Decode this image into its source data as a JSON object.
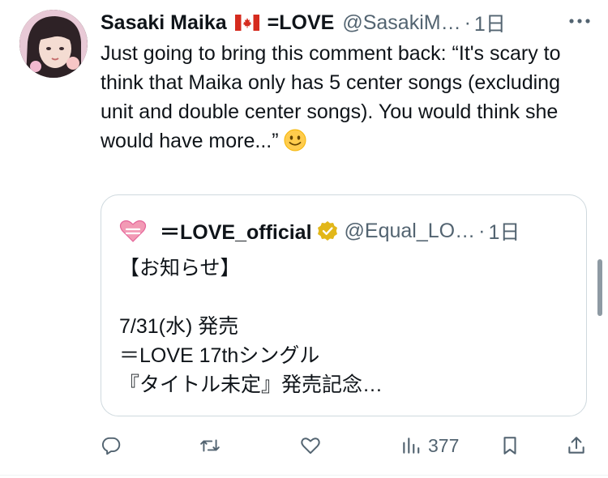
{
  "post": {
    "display_name": "Sasaki Maika",
    "display_name_suffix": "=LOVE",
    "handle": "@SasakiM…",
    "separator": "·",
    "time": "1日",
    "text": "Just going to bring this comment back: “It's scary to think that Maika only has 5 center songs (excluding unit and double center songs). You would think she would have more...”"
  },
  "quote": {
    "display_name": "＝LOVE_official",
    "handle": "@Equal_LO…",
    "separator": "·",
    "time": "1日",
    "text": "【お知らせ】\n\n7/31(水) 発売\n＝LOVE 17thシングル\n『タイトル未定』発売記念…"
  },
  "actions": {
    "views": "377"
  },
  "colors": {
    "text": "#0f1419",
    "secondary": "#536471",
    "border": "#cfd9de",
    "verified_gold": "#e2b719"
  },
  "icons": [
    "avatar",
    "canada-flag-icon",
    "more-icon",
    "smile-emoji-icon",
    "equal-love-logo-icon",
    "verified-badge-icon",
    "reply-icon",
    "retweet-icon",
    "like-icon",
    "views-icon",
    "bookmark-icon",
    "share-icon"
  ]
}
